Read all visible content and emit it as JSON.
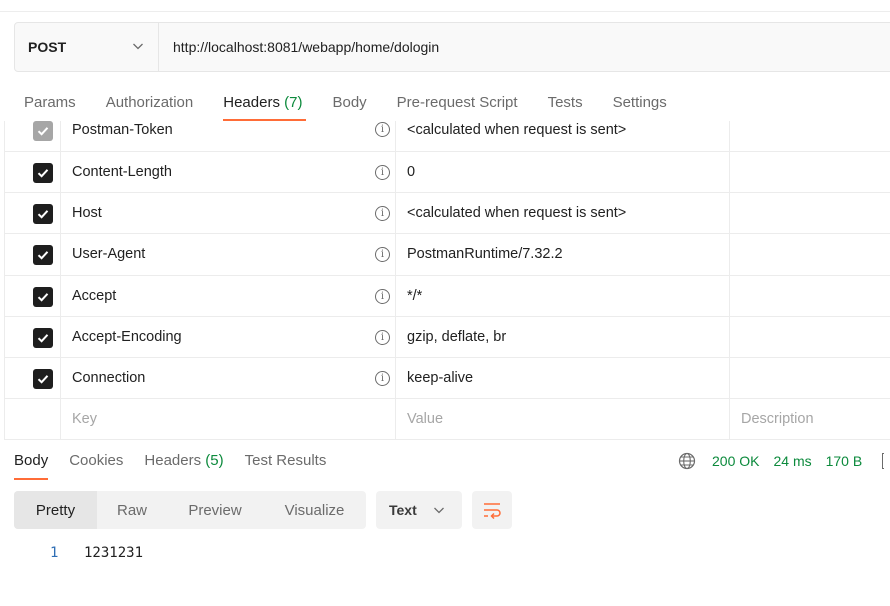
{
  "request": {
    "method": "POST",
    "url": "http://localhost:8081/webapp/home/dologin"
  },
  "request_tabs": [
    {
      "label": "Params"
    },
    {
      "label": "Authorization"
    },
    {
      "label": "Headers",
      "count": "(7)",
      "active": true
    },
    {
      "label": "Body"
    },
    {
      "label": "Pre-request Script"
    },
    {
      "label": "Tests"
    },
    {
      "label": "Settings"
    }
  ],
  "headers": [
    {
      "key": "Postman-Token",
      "value": "<calculated when request is sent>",
      "checked": true,
      "disabled": true
    },
    {
      "key": "Content-Length",
      "value": "0",
      "checked": true
    },
    {
      "key": "Host",
      "value": "<calculated when request is sent>",
      "checked": true
    },
    {
      "key": "User-Agent",
      "value": "PostmanRuntime/7.32.2",
      "checked": true
    },
    {
      "key": "Accept",
      "value": "*/*",
      "checked": true
    },
    {
      "key": "Accept-Encoding",
      "value": "gzip, deflate, br",
      "checked": true
    },
    {
      "key": "Connection",
      "value": "keep-alive",
      "checked": true
    }
  ],
  "new_row": {
    "key_placeholder": "Key",
    "value_placeholder": "Value",
    "description_placeholder": "Description"
  },
  "response_tabs": [
    {
      "label": "Body",
      "active": true
    },
    {
      "label": "Cookies"
    },
    {
      "label": "Headers",
      "count": "(5)"
    },
    {
      "label": "Test Results"
    }
  ],
  "response_status": {
    "code": "200 OK",
    "time": "24 ms",
    "size": "170 B"
  },
  "view_modes": [
    "Pretty",
    "Raw",
    "Preview",
    "Visualize"
  ],
  "active_view_mode": "Pretty",
  "format": "Text",
  "body_lines": [
    {
      "number": "1",
      "text": "1231231"
    }
  ],
  "colors": {
    "accent": "#ff6c37",
    "success": "#0c8a3c",
    "line_number": "#2f6eb5"
  }
}
